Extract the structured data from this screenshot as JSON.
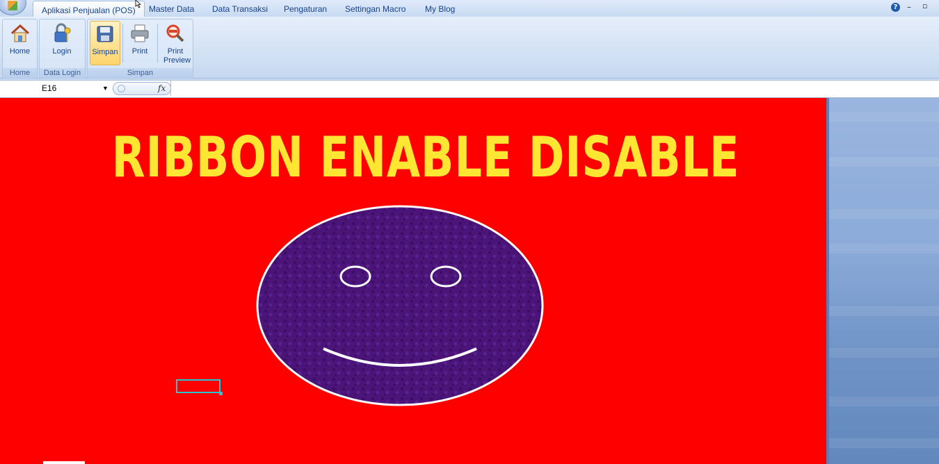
{
  "tabs": [
    {
      "label": "Aplikasi Penjualan (POS)",
      "active": true
    },
    {
      "label": "Master Data"
    },
    {
      "label": "Data Transaksi"
    },
    {
      "label": "Pengaturan"
    },
    {
      "label": "Settingan Macro"
    },
    {
      "label": "My Blog"
    }
  ],
  "window_controls": {
    "help": "?",
    "minimize": "–",
    "restore": "▫"
  },
  "ribbon": {
    "groups": [
      {
        "label": "Home",
        "buttons": [
          {
            "label": "Home",
            "icon": "home-icon"
          }
        ]
      },
      {
        "label": "Data Login",
        "buttons": [
          {
            "label": "Login",
            "icon": "lock-key-icon"
          }
        ]
      },
      {
        "label": "Simpan",
        "buttons": [
          {
            "label": "Simpan",
            "icon": "floppy-disk-icon",
            "selected": true
          },
          {
            "label": "Print",
            "icon": "printer-icon"
          },
          {
            "label": "Print Preview",
            "icon": "magnifier-icon"
          }
        ]
      }
    ]
  },
  "formula_bar": {
    "name_box": "E16",
    "fx": "fx",
    "value": ""
  },
  "sheet": {
    "title": "RIBBON ENABLE DISABLE",
    "background_color": "#ff0000",
    "title_color": "#ffe633",
    "face_color": "#4a1478",
    "selection_color": "#27c5d8"
  }
}
